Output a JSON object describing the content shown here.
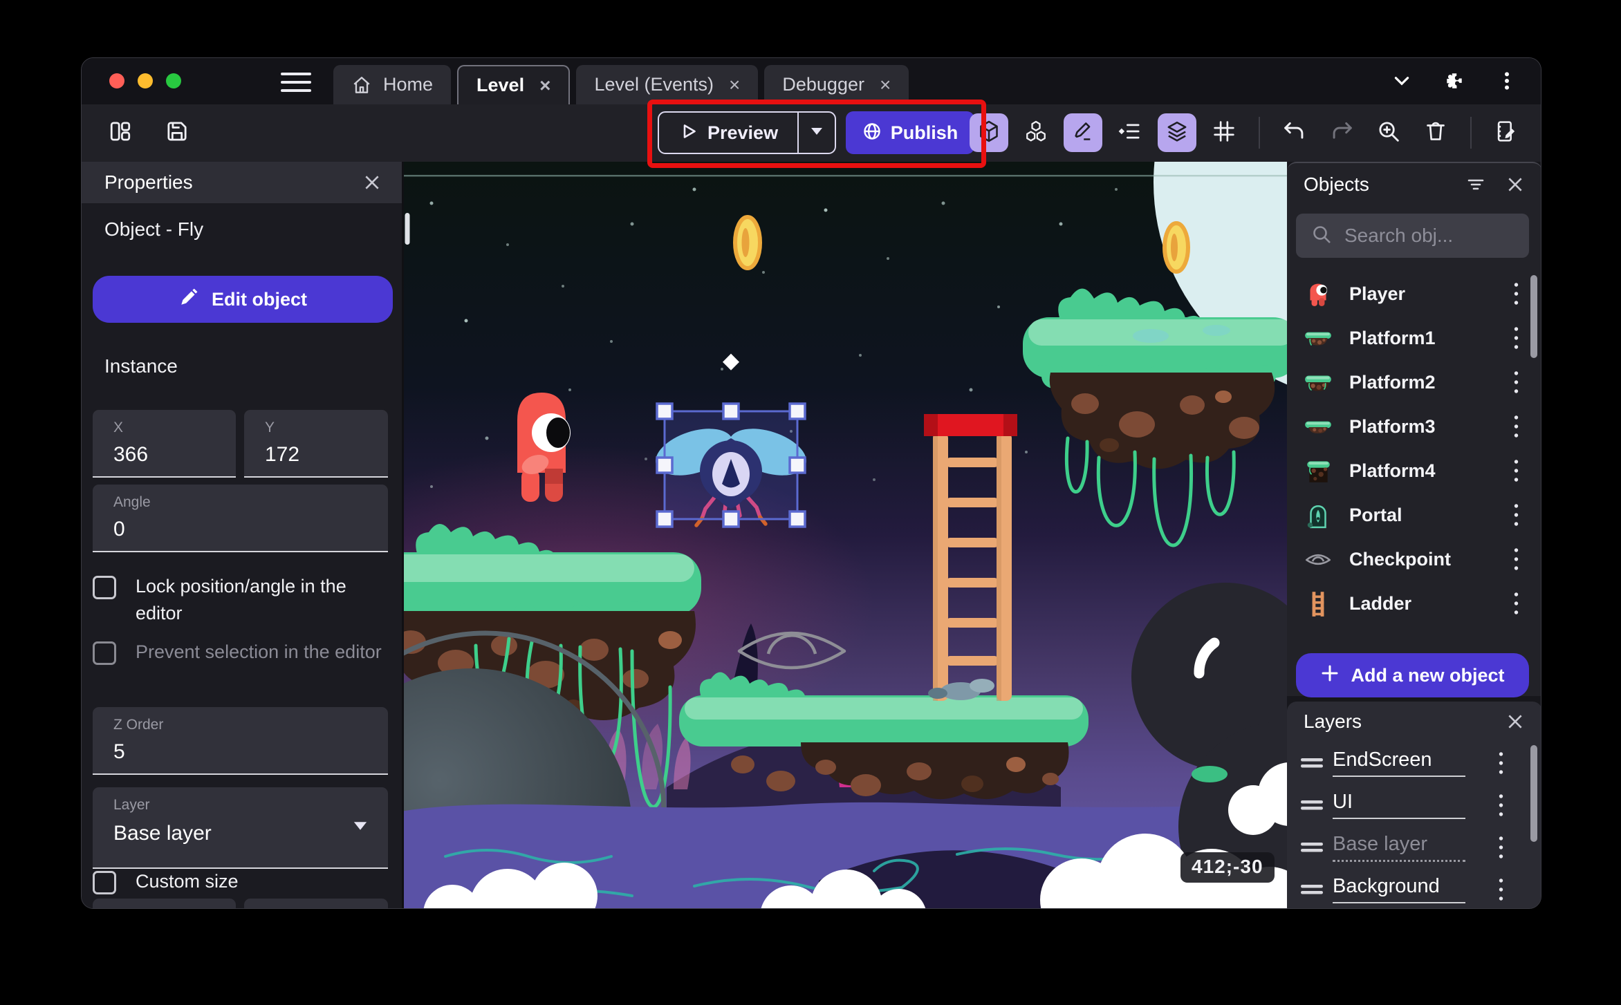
{
  "titlebar": {
    "traffic_lights": [
      "#ff5f57",
      "#febc2e",
      "#28c840"
    ],
    "right_icons": [
      "chevron-down-icon",
      "extensions-icon",
      "more-icon"
    ]
  },
  "tabs": [
    {
      "label": "Home",
      "icon": "home",
      "active": false,
      "closable": false
    },
    {
      "label": "Level",
      "icon": "",
      "active": true,
      "closable": true
    },
    {
      "label": "Level (Events)",
      "icon": "",
      "active": false,
      "closable": true
    },
    {
      "label": "Debugger",
      "icon": "",
      "active": false,
      "closable": true
    }
  ],
  "toolbar": {
    "left_icons": [
      "panels-icon",
      "save-icon"
    ],
    "preview_label": "Preview",
    "publish_label": "Publish",
    "right_icons": [
      {
        "name": "view-3d-icon",
        "active": true
      },
      {
        "name": "objects-cubes-icon",
        "active": false
      },
      {
        "name": "edit-pencil-icon",
        "active": true
      },
      {
        "name": "instances-list-icon",
        "active": false
      },
      {
        "name": "layers-stack-icon",
        "active": true
      },
      {
        "name": "grid-icon",
        "active": false
      },
      {
        "name": "separator"
      },
      {
        "name": "undo-icon",
        "active": false
      },
      {
        "name": "redo-icon",
        "active": false
      },
      {
        "name": "zoom-in-icon",
        "active": false
      },
      {
        "name": "trash-icon",
        "active": false
      },
      {
        "name": "separator"
      },
      {
        "name": "scene-edit-icon",
        "active": false
      }
    ]
  },
  "properties_panel": {
    "title": "Properties",
    "object_label": "Object  - Fly",
    "edit_button": "Edit object",
    "instance_section": "Instance",
    "fields": {
      "x_label": "X",
      "x_value": "366",
      "y_label": "Y",
      "y_value": "172",
      "angle_label": "Angle",
      "angle_value": "0",
      "zorder_label": "Z Order",
      "zorder_value": "5",
      "layer_label": "Layer",
      "layer_value": "Base layer"
    },
    "checkboxes": {
      "lock": "Lock position/angle in the editor",
      "prevent": "Prevent selection in the editor",
      "custom_size": "Custom size"
    }
  },
  "objects_panel": {
    "title": "Objects",
    "search_placeholder": "Search obj...",
    "items": [
      {
        "name": "Player",
        "icon": "player"
      },
      {
        "name": "Platform1",
        "icon": "platform-grass"
      },
      {
        "name": "Platform2",
        "icon": "platform-rocky"
      },
      {
        "name": "Platform3",
        "icon": "platform-flat"
      },
      {
        "name": "Platform4",
        "icon": "platform-ground"
      },
      {
        "name": "Portal",
        "icon": "portal"
      },
      {
        "name": "Checkpoint",
        "icon": "checkpoint-eye"
      },
      {
        "name": "Ladder",
        "icon": "ladder"
      }
    ],
    "add_button": "Add a new object"
  },
  "layers_panel": {
    "title": "Layers",
    "items": [
      {
        "name": "EndScreen",
        "dimmed": false
      },
      {
        "name": "UI",
        "dimmed": false
      },
      {
        "name": "Base layer",
        "dimmed": true
      },
      {
        "name": "Background",
        "dimmed": false
      }
    ]
  },
  "canvas": {
    "selected_object": "Fly",
    "coords_badge": "412;-30"
  },
  "colors": {
    "accent": "#4B38D3",
    "annotation": "#E81010",
    "toolbar_active_bg": "#B7A6EE"
  }
}
